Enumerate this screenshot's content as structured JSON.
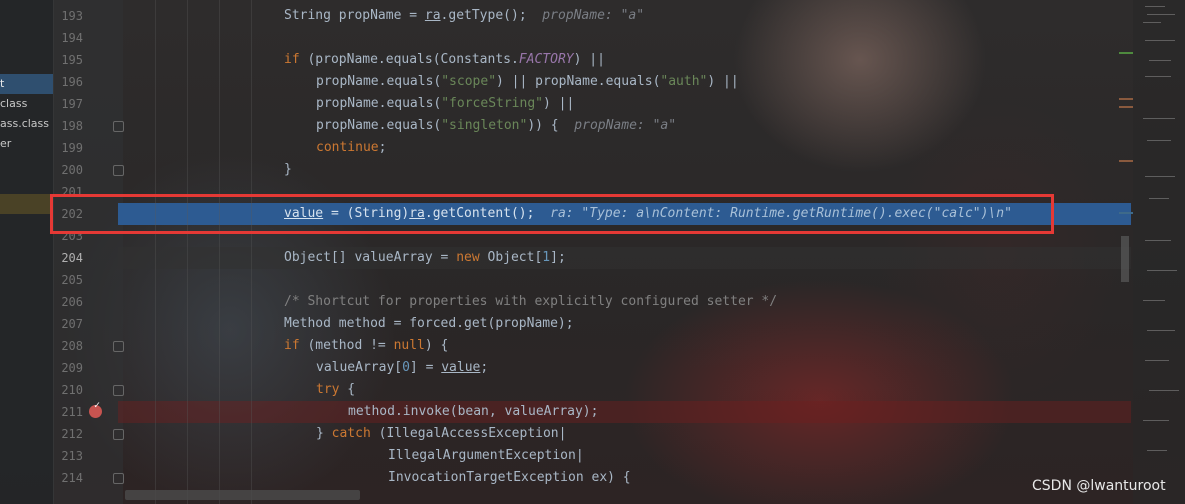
{
  "project_tree": [
    {
      "label": "t",
      "selected": true
    },
    {
      "label": "class"
    },
    {
      "label": "ass.class"
    },
    {
      "label": "er"
    }
  ],
  "line_numbers": [
    "193",
    "194",
    "195",
    "196",
    "197",
    "198",
    "199",
    "200",
    "201",
    "202",
    "203",
    "204",
    "205",
    "206",
    "207",
    "208",
    "209",
    "210",
    "211",
    "212",
    "213",
    "214"
  ],
  "code": {
    "l193": {
      "a": "String propName = ",
      "b": "ra",
      "c": ".getType();",
      "hint": "propName: \"a\""
    },
    "l195": {
      "kw": "if",
      "a": " (propName.equals(Constants.",
      "static": "FACTORY",
      "b": ") ||"
    },
    "l196": {
      "a": "propName.equals(",
      "s1": "\"scope\"",
      "b": ") || propName.equals(",
      "s2": "\"auth\"",
      "c": ") ||"
    },
    "l197": {
      "a": "propName.equals(",
      "s1": "\"forceString\"",
      "b": ") ||"
    },
    "l198": {
      "a": "propName.equals(",
      "s1": "\"singleton\"",
      "b": ")) {",
      "hint": "propName: \"a\""
    },
    "l199": {
      "kw": "continue",
      "a": ";"
    },
    "l200": {
      "a": "}"
    },
    "l202": {
      "a": "value",
      "b": " = (String)",
      "c": "ra",
      "d": ".getContent();",
      "hint": "ra: \"Type: a\\nContent: Runtime.getRuntime().exec(\"calc\")\\n\""
    },
    "l204": {
      "a": "Object[] valueArray = ",
      "kw": "new",
      "b": " Object[",
      "n": "1",
      "c": "];"
    },
    "l206": {
      "cmt": "/* Shortcut for properties with explicitly configured setter */"
    },
    "l207": {
      "a": "Method method = forced.get(propName);"
    },
    "l208": {
      "kw": "if",
      "a": " (method != ",
      "kw2": "null",
      "b": ") {"
    },
    "l209": {
      "a": "valueArray[",
      "n": "0",
      "b": "] = ",
      "c": "value",
      "d": ";"
    },
    "l210": {
      "kw": "try",
      "a": " {"
    },
    "l211": {
      "a": "method.invoke(bean, valueArray);"
    },
    "l212": {
      "a": "} ",
      "kw": "catch",
      "b": " (IllegalAccessException|"
    },
    "l213": {
      "a": "IllegalArgumentException|"
    },
    "l214": {
      "a": "InvocationTargetException ex) {"
    }
  },
  "watermark": "CSDN @lwanturoot"
}
